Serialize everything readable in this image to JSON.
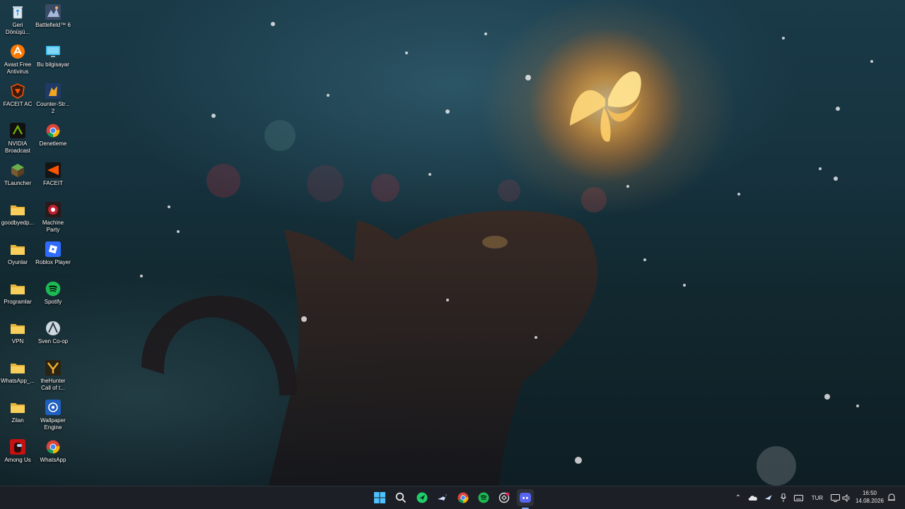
{
  "desktop": {
    "column1": [
      {
        "label": "Geri\nDönüşü...",
        "icon": "recycle-bin-icon"
      },
      {
        "label": "Avast Free\nAntivirus",
        "icon": "avast-icon"
      },
      {
        "label": "FACEIT AC",
        "icon": "faceit-ac-icon"
      },
      {
        "label": "NVIDIA\nBroadcast",
        "icon": "nvidia-broadcast-icon"
      },
      {
        "label": "TLauncher",
        "icon": "tlauncher-icon"
      },
      {
        "label": "goodbyedp...",
        "icon": "folder-icon"
      },
      {
        "label": "Oyunlar",
        "icon": "folder-icon"
      },
      {
        "label": "Programlar",
        "icon": "folder-icon"
      },
      {
        "label": "VPN",
        "icon": "folder-icon"
      },
      {
        "label": "WhatsApp_...",
        "icon": "folder-icon"
      },
      {
        "label": "Zilan",
        "icon": "folder-icon"
      },
      {
        "label": "Among Us",
        "icon": "among-us-icon"
      }
    ],
    "column2": [
      {
        "label": "Battlefield™ 6",
        "icon": "battlefield-icon"
      },
      {
        "label": "Bu bilgisayar",
        "icon": "this-pc-icon"
      },
      {
        "label": "Counter-Str...\n2",
        "icon": "counter-strike-icon"
      },
      {
        "label": "Denetleme",
        "icon": "chrome-icon"
      },
      {
        "label": "FACEIT",
        "icon": "faceit-icon"
      },
      {
        "label": "Machine\nParty",
        "icon": "machine-party-icon"
      },
      {
        "label": "Roblox Player",
        "icon": "roblox-icon"
      },
      {
        "label": "Spotify",
        "icon": "spotify-icon"
      },
      {
        "label": "Sven Co-op",
        "icon": "sven-coop-icon"
      },
      {
        "label": "theHunter\nCall of t...",
        "icon": "thehunter-icon"
      },
      {
        "label": "Wallpaper\nEngine",
        "icon": "wallpaper-engine-icon"
      },
      {
        "label": "WhatsApp",
        "icon": "chrome-icon"
      }
    ]
  },
  "taskbar": {
    "apps": [
      "start-icon",
      "search-icon",
      "ai-assistant-icon",
      "steam-icon",
      "chrome-icon",
      "spotify-icon",
      "chatgpt-icon",
      "discord-icon"
    ],
    "tray": {
      "language": "TUR",
      "time": "16:50",
      "date": "14.08.2026"
    }
  },
  "colors": {
    "taskbar_bg": "#1c2026",
    "spotify": "#1db954",
    "discord": "#5865f2",
    "folder": "#f2c14e"
  }
}
